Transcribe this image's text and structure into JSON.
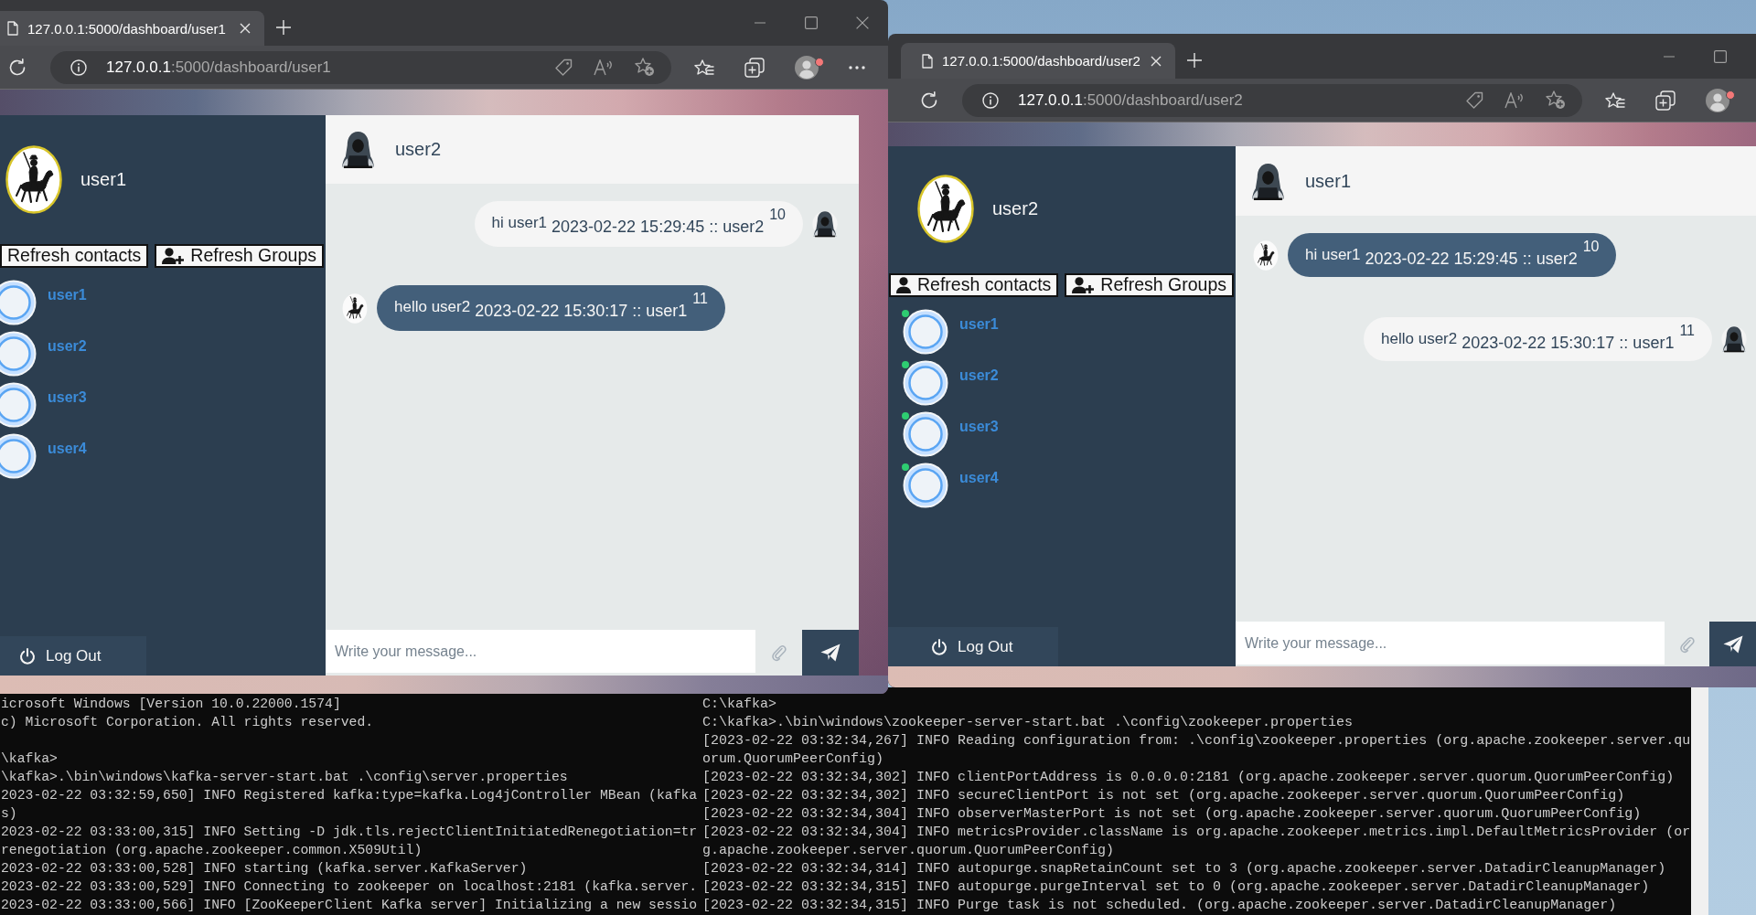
{
  "browsers": [
    {
      "tab": {
        "title": "127.0.0.1:5000/dashboard/user1"
      },
      "address": {
        "host": "127.0.0.1",
        "path": ":5000/dashboard/user1"
      },
      "sidebar": {
        "profile_name": "user1",
        "buttons": [
          {
            "kind": "contacts",
            "label": "Refresh contacts"
          },
          {
            "kind": "groups",
            "label": "Refresh Groups"
          }
        ],
        "contacts": [
          {
            "name": "user1"
          },
          {
            "name": "user2"
          },
          {
            "name": "user3"
          },
          {
            "name": "user4"
          }
        ],
        "logout": "Log Out"
      },
      "chat": {
        "contact_name": "user2",
        "messages": [
          {
            "kind": "received",
            "text": "hi user1",
            "timestamp": "2023-02-22 15:29:45 :: user2",
            "number": "10"
          },
          {
            "kind": "sent",
            "text": "hello user2",
            "timestamp": "2023-02-22 15:30:17 :: user1",
            "number": "11"
          }
        ],
        "input": {
          "placeholder": "Write your message..."
        }
      }
    },
    {
      "tab": {
        "title": "127.0.0.1:5000/dashboard/user2"
      },
      "address": {
        "host": "127.0.0.1",
        "path": ":5000/dashboard/user2"
      },
      "sidebar": {
        "profile_name": "user2",
        "buttons": [
          {
            "kind": "contacts",
            "label": "Refresh contacts"
          },
          {
            "kind": "groups",
            "label": "Refresh Groups"
          }
        ],
        "contacts": [
          {
            "name": "user1",
            "online": true
          },
          {
            "name": "user2",
            "online": true
          },
          {
            "name": "user3",
            "online": true
          },
          {
            "name": "user4",
            "online": true
          }
        ],
        "logout": "Log Out"
      },
      "chat": {
        "contact_name": "user1",
        "messages": [
          {
            "kind": "sent",
            "text": "hi user1",
            "timestamp": "2023-02-22 15:29:45 :: user2",
            "number": "10"
          },
          {
            "kind": "received",
            "text": "hello user2",
            "timestamp": "2023-02-22 15:30:17 :: user1",
            "number": "11"
          }
        ],
        "input": {
          "placeholder": "Write your message..."
        }
      }
    }
  ],
  "terminals": [
    {
      "blocks": [
        [
          "icrosoft Windows [Version 10.0.22000.1574]",
          "c) Microsoft Corporation. All rights reserved."
        ],
        [
          "\\kafka>",
          "\\kafka>.\\bin\\windows\\kafka-server-start.bat .\\config\\server.properties",
          "2023-02-22 03:32:59,650] INFO Registered kafka:type=kafka.Log4jController MBean (kafka",
          "s)",
          "2023-02-22 03:33:00,315] INFO Setting -D jdk.tls.rejectClientInitiatedRenegotiation=tr",
          "renegotiation (org.apache.zookeeper.common.X509Util)",
          "2023-02-22 03:33:00,528] INFO starting (kafka.server.KafkaServer)",
          "2023-02-22 03:33:00,529] INFO Connecting to zookeeper on localhost:2181 (kafka.server.",
          "2023-02-22 03:33:00,566] INFO [ZooKeeperClient Kafka server] Initializing a new sessio"
        ]
      ]
    },
    {
      "blocks": [
        [
          "C:\\kafka>",
          "C:\\kafka>.\\bin\\windows\\zookeeper-server-start.bat .\\config\\zookeeper.properties",
          "[2023-02-22 03:32:34,267] INFO Reading configuration from: .\\config\\zookeeper.properties (org.apache.zookeeper.server.qu",
          "orum.QuorumPeerConfig)",
          "[2023-02-22 03:32:34,302] INFO clientPortAddress is 0.0.0.0:2181 (org.apache.zookeeper.server.quorum.QuorumPeerConfig)",
          "[2023-02-22 03:32:34,302] INFO secureClientPort is not set (org.apache.zookeeper.server.quorum.QuorumPeerConfig)",
          "[2023-02-22 03:32:34,304] INFO observerMasterPort is not set (org.apache.zookeeper.server.quorum.QuorumPeerConfig)",
          "[2023-02-22 03:32:34,304] INFO metricsProvider.className is org.apache.zookeeper.metrics.impl.DefaultMetricsProvider (or",
          "g.apache.zookeeper.server.quorum.QuorumPeerConfig)",
          "[2023-02-22 03:32:34,314] INFO autopurge.snapRetainCount set to 3 (org.apache.zookeeper.server.DatadirCleanupManager)",
          "[2023-02-22 03:32:34,315] INFO autopurge.purgeInterval set to 0 (org.apache.zookeeper.server.DatadirCleanupManager)",
          "[2023-02-22 03:32:34,315] INFO Purge task is not scheduled. (org.apache.zookeeper.server.DatadirCleanupManager)"
        ]
      ]
    }
  ]
}
